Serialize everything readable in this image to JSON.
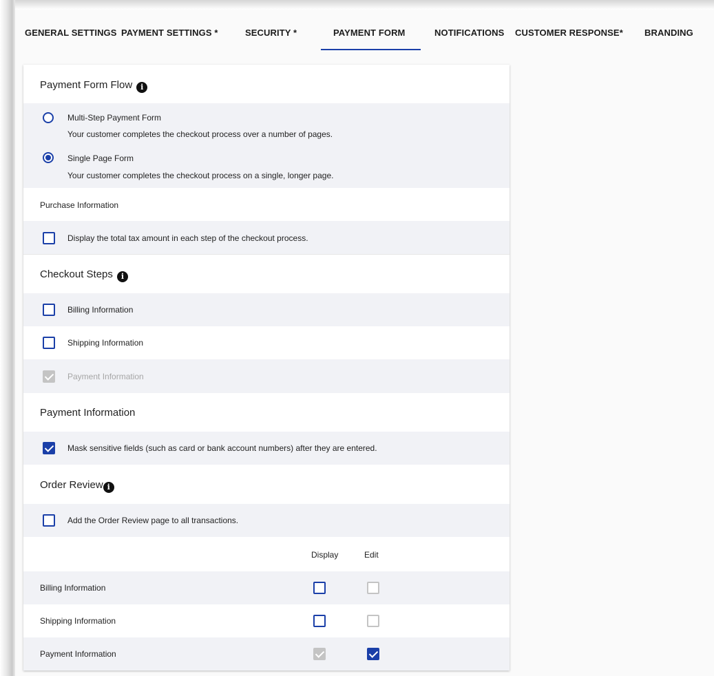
{
  "tabs": [
    {
      "label": "GENERAL SETTINGS"
    },
    {
      "label": "PAYMENT SETTINGS *"
    },
    {
      "label": "SECURITY *"
    },
    {
      "label": "PAYMENT FORM",
      "active": true
    },
    {
      "label": "NOTIFICATIONS"
    },
    {
      "label": "CUSTOMER RESPONSE*"
    },
    {
      "label": "BRANDING"
    }
  ],
  "flow": {
    "title": "Payment Form Flow",
    "options": [
      {
        "label": "Multi-Step Payment Form",
        "description": "Your customer completes the checkout process over a number of pages.",
        "selected": false
      },
      {
        "label": "Single Page Form",
        "description": "Your customer completes the checkout process on a single, longer page.",
        "selected": true
      }
    ]
  },
  "purchase": {
    "title": "Purchase Information",
    "tax_label": "Display the total tax amount in each step of the checkout process.",
    "tax_checked": false
  },
  "checkout": {
    "title": "Checkout Steps",
    "steps": [
      {
        "label": "Billing Information",
        "checked": false,
        "disabled": false
      },
      {
        "label": "Shipping Information",
        "checked": false,
        "disabled": false
      },
      {
        "label": "Payment Information",
        "checked": true,
        "disabled": true
      }
    ]
  },
  "payment_info": {
    "title": "Payment Information",
    "mask_label": "Mask sensitive fields (such as card or bank account numbers) after they are entered.",
    "mask_checked": true
  },
  "order_review": {
    "title": "Order Review",
    "add_label": "Add the Order Review page to all transactions.",
    "add_checked": false,
    "col_display": "Display",
    "col_edit": "Edit",
    "rows": [
      {
        "label": "Billing Information",
        "display": "unchecked",
        "edit": "disabled"
      },
      {
        "label": "Shipping Information",
        "display": "unchecked",
        "edit": "disabled"
      },
      {
        "label": "Payment Information",
        "display": "disabled-checked",
        "edit": "checked"
      }
    ]
  },
  "colors": {
    "accent": "#1a3fa8",
    "shaded_row": "#f1f2f6",
    "disabled": "#c4c4c4"
  },
  "icons": {
    "info": "info-circle-icon",
    "radio": "radio-button-icon",
    "checkbox": "checkbox-icon"
  }
}
